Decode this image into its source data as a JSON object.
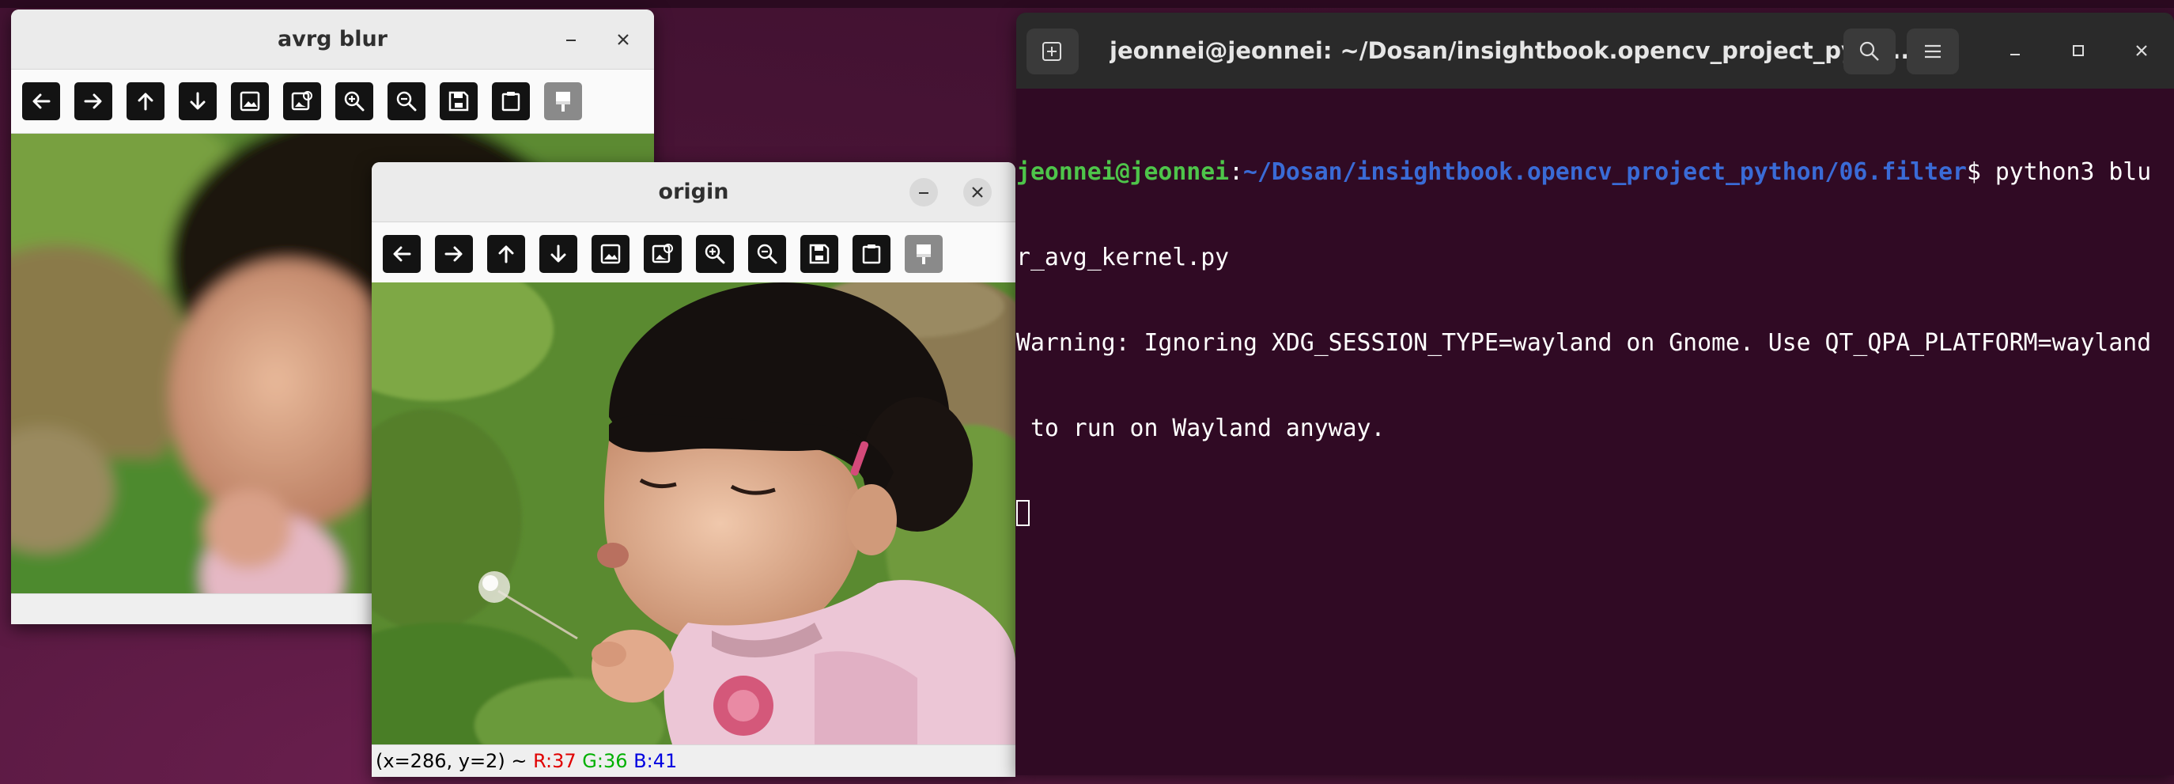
{
  "windows": {
    "avrg_blur": {
      "title": "avrg blur"
    },
    "origin": {
      "title": "origin",
      "status": {
        "coords": "(x=286, y=2) ~",
        "r": "R:37",
        "g": "G:36",
        "b": "B:41"
      }
    }
  },
  "toolbar_icons": [
    "pan-left-icon",
    "pan-right-icon",
    "pan-up-icon",
    "pan-down-icon",
    "zoom-original-icon",
    "zoom-fit-icon",
    "zoom-in-icon",
    "zoom-out-icon",
    "save-icon",
    "properties-icon",
    "overlay-icon"
  ],
  "terminal": {
    "title": "jeonnei@jeonnei: ~/Dosan/insightbook.opencv_project_pyth...",
    "prompt_user": "jeonnei@jeonnei",
    "prompt_sep": ":",
    "prompt_path": "~/Dosan/insightbook.opencv_project_python/06.filter",
    "prompt_symbol": "$ ",
    "command_part1": "python3 blu",
    "command_part2": "r_avg_kernel.py",
    "output_line1": "Warning: Ignoring XDG_SESSION_TYPE=wayland on Gnome. Use QT_QPA_PLATFORM=wayland",
    "output_line2": " to run on Wayland anyway."
  },
  "colors": {
    "terminal_bg": "#300a24",
    "prompt_user": "#4ec54a",
    "prompt_path": "#3a6bd6",
    "status_r": "#e00000",
    "status_g": "#00b000",
    "status_b": "#0000e0"
  }
}
